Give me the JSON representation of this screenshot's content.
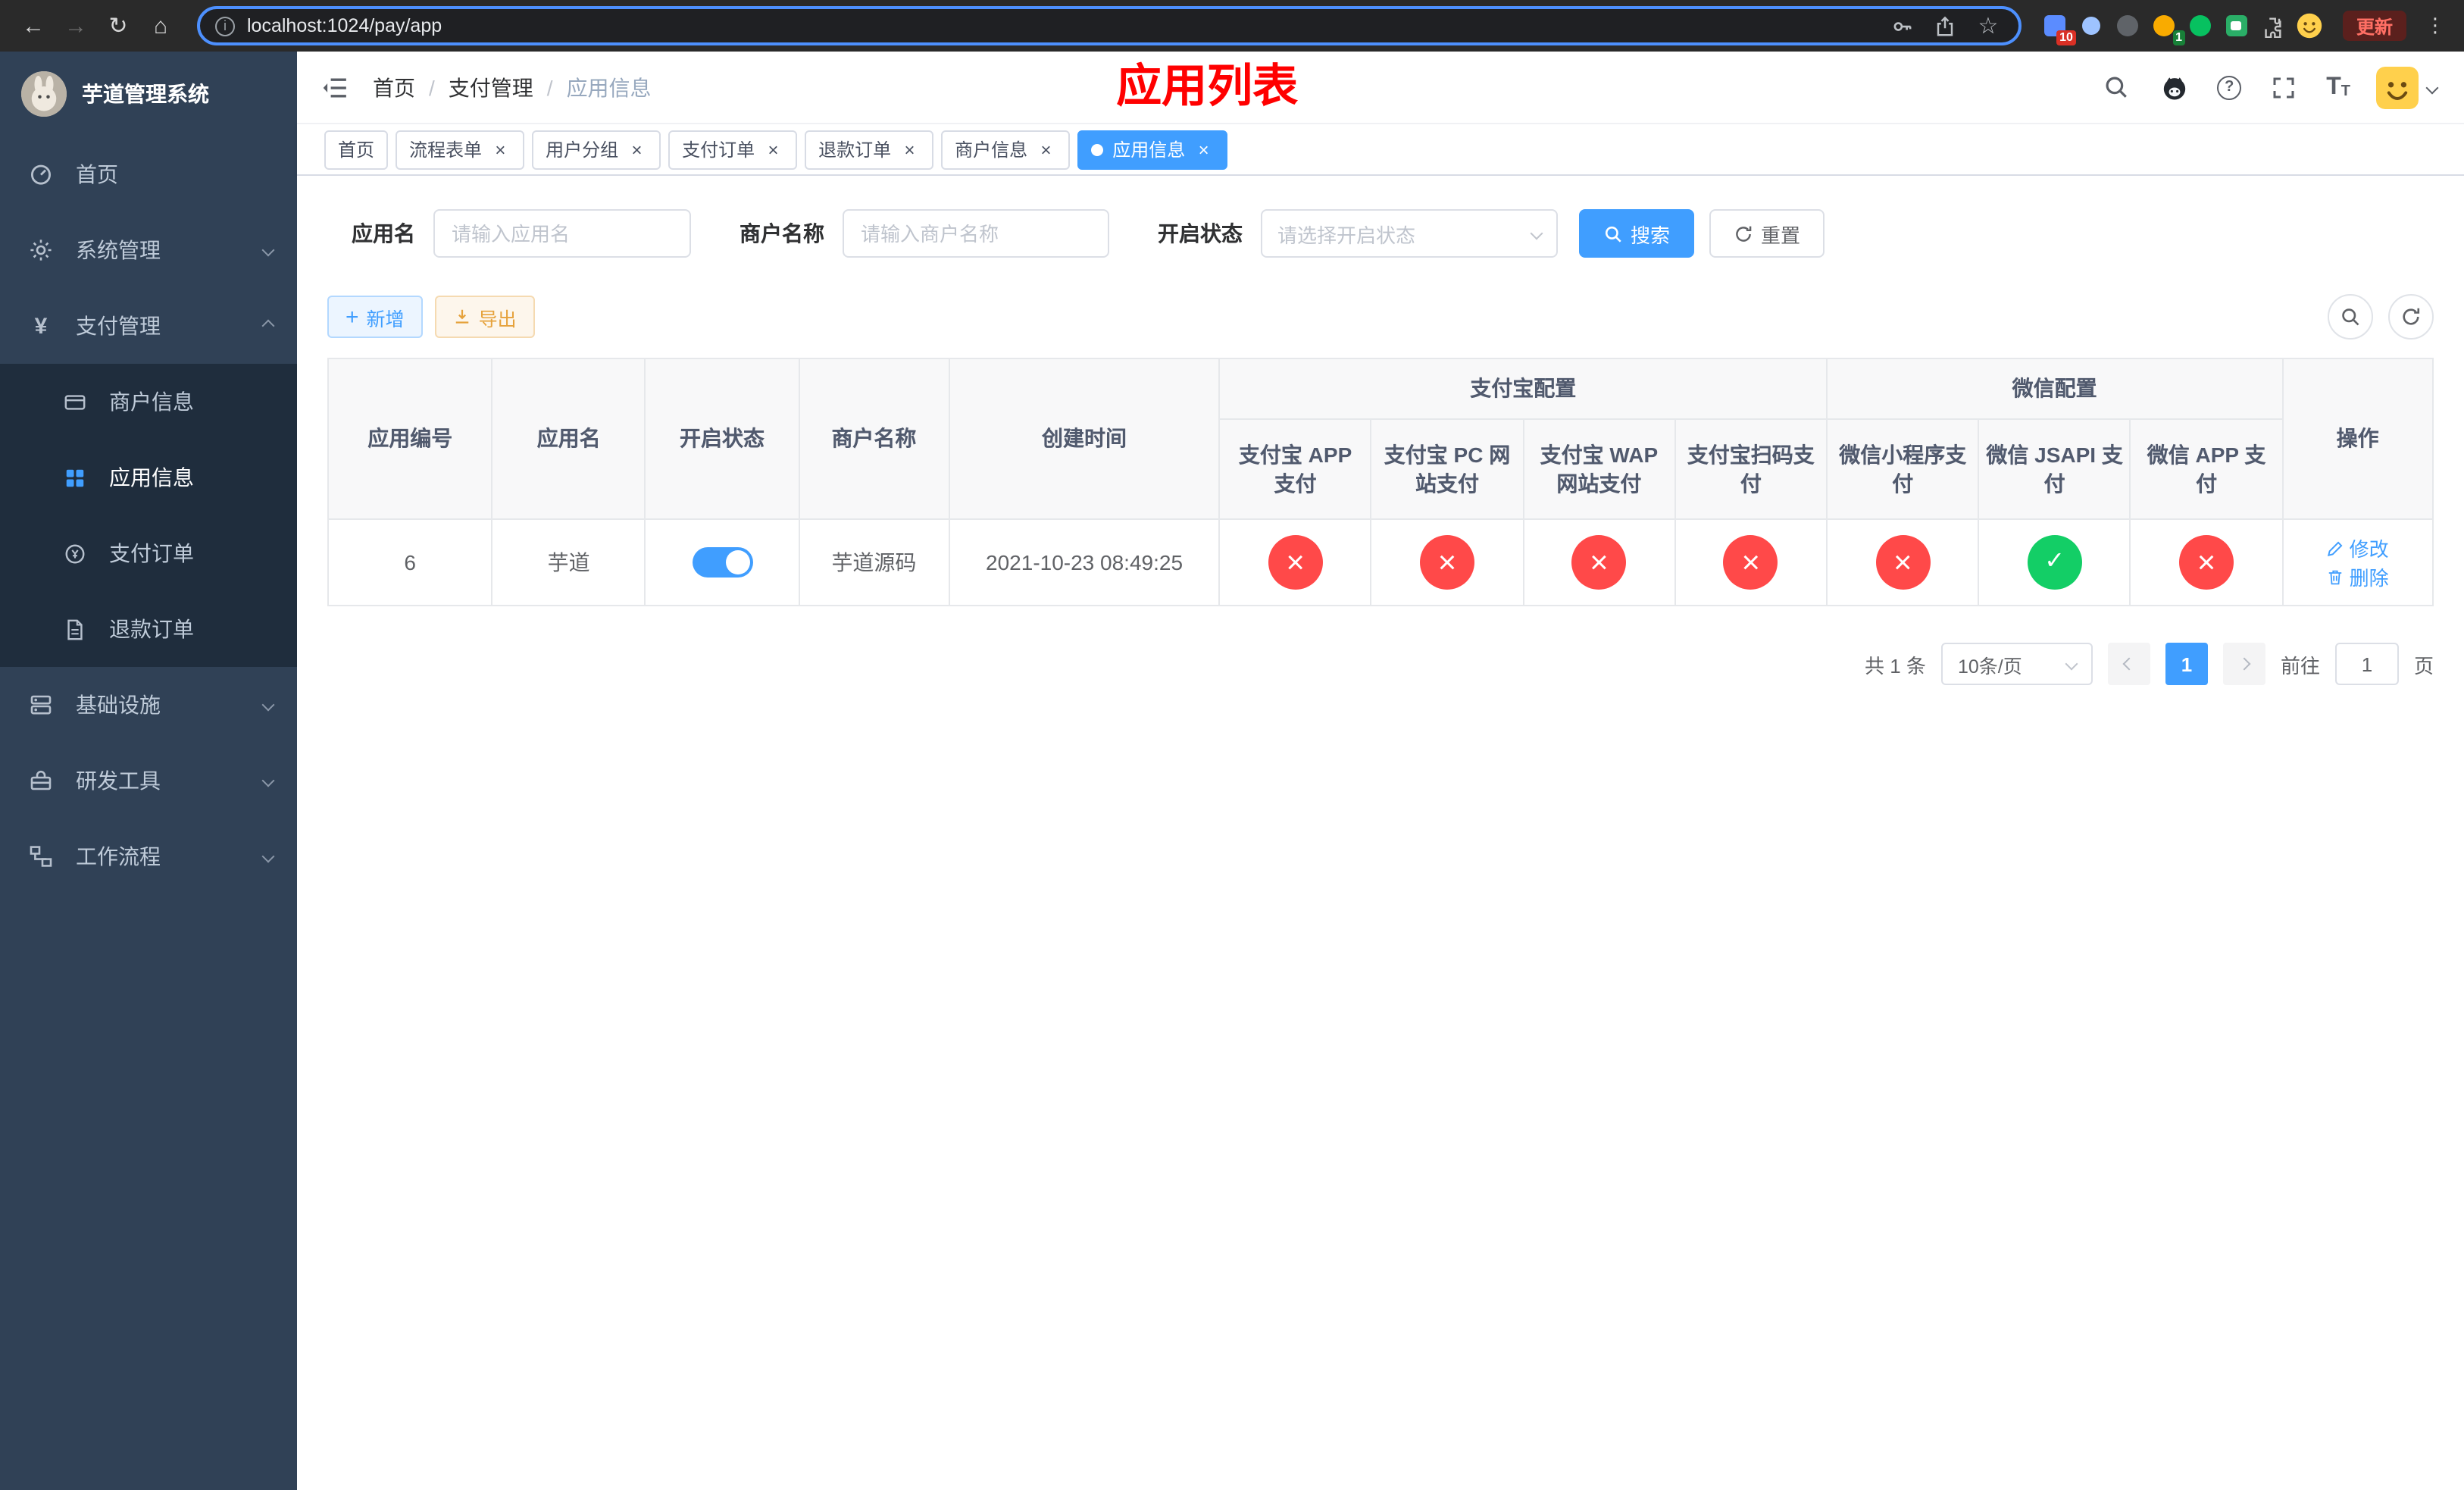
{
  "colors": {
    "primary": "#409eff",
    "success": "#13ce66",
    "danger": "#ff4949",
    "warning": "#e6a23c",
    "sidebar-bg": "#304156",
    "submenu-bg": "#1f2d3d",
    "annotation": "#ff0000"
  },
  "browser": {
    "url": "localhost:1024/pay/app",
    "update_label": "更新",
    "ext_badge_blue": "10",
    "ext_badge_avatar": "1"
  },
  "sidebar": {
    "title": "芋道管理系统",
    "items": {
      "home": "首页",
      "system": "系统管理",
      "pay": "支付管理",
      "merchant": "商户信息",
      "app": "应用信息",
      "order": "支付订单",
      "refund": "退款订单",
      "infra": "基础设施",
      "devtools": "研发工具",
      "workflow": "工作流程"
    }
  },
  "navbar": {
    "breadcrumb": {
      "home": "首页",
      "pay": "支付管理",
      "current": "应用信息"
    },
    "annotation": "应用列表"
  },
  "tabs": [
    {
      "label": "首页"
    },
    {
      "label": "流程表单"
    },
    {
      "label": "用户分组"
    },
    {
      "label": "支付订单"
    },
    {
      "label": "退款订单"
    },
    {
      "label": "商户信息"
    },
    {
      "label": "应用信息"
    }
  ],
  "filters": {
    "app_name_label": "应用名",
    "app_name_placeholder": "请输入应用名",
    "merchant_label": "商户名称",
    "merchant_placeholder": "请输入商户名称",
    "status_label": "开启状态",
    "status_placeholder": "请选择开启状态",
    "search_label": "搜索",
    "reset_label": "重置"
  },
  "toolbar": {
    "add_label": "新增",
    "export_label": "导出"
  },
  "table": {
    "groups": {
      "alipay": "支付宝配置",
      "wechat": "微信配置"
    },
    "columns": {
      "id": "应用编号",
      "name": "应用名",
      "status": "开启状态",
      "merchant": "商户名称",
      "created": "创建时间",
      "alipay_app": "支付宝 APP 支付",
      "alipay_pc": "支付宝 PC 网站支付",
      "alipay_wap": "支付宝 WAP 网站支付",
      "alipay_qr": "支付宝扫码支付",
      "wx_mini": "微信小程序支付",
      "wx_jsapi": "微信 JSAPI 支付",
      "wx_app": "微信 APP 支付",
      "actions": "操作"
    },
    "edit_label": "修改",
    "delete_label": "删除",
    "rows": [
      {
        "id": "6",
        "name": "芋道",
        "status": "on",
        "merchant": "芋道源码",
        "created": "2021-10-23 08:49:25",
        "configs": [
          "off",
          "off",
          "off",
          "off",
          "off",
          "on",
          "off"
        ]
      }
    ]
  },
  "pagination": {
    "total": "共 1 条",
    "page_size": "10条/页",
    "page": "1",
    "goto_label": "前往",
    "goto_value": "1",
    "page_unit": "页"
  }
}
